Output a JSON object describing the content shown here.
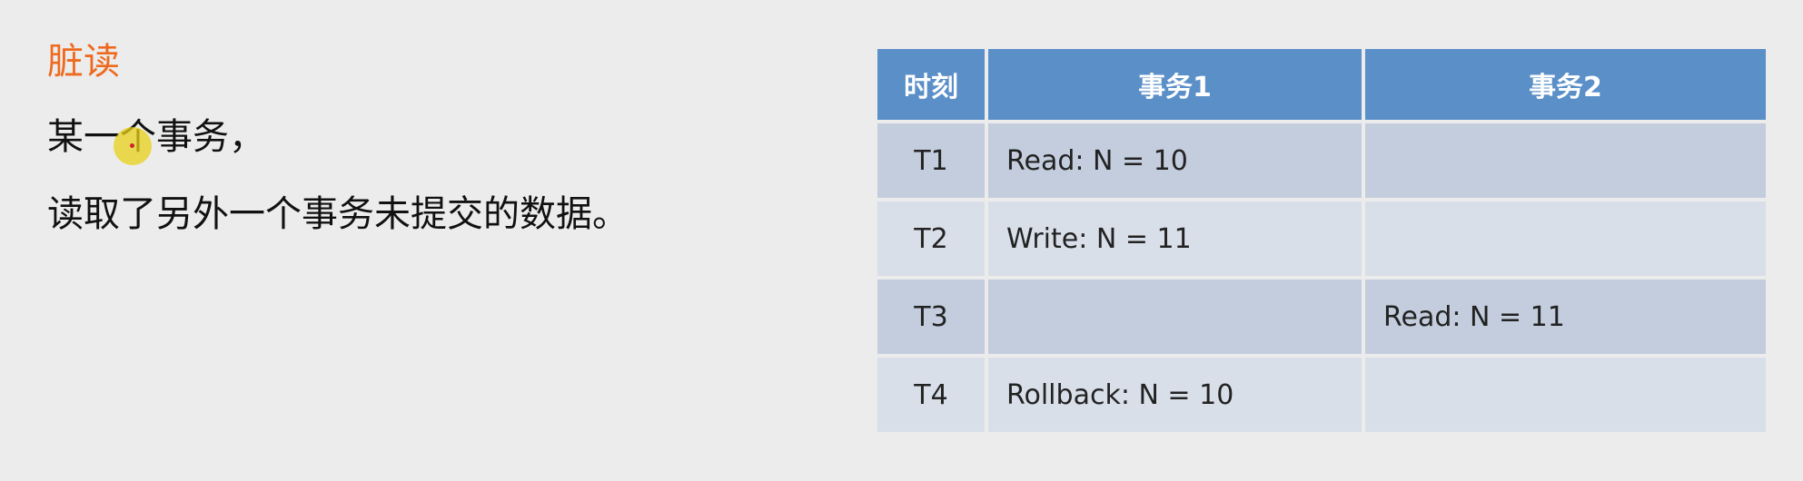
{
  "slide": {
    "title": "脏读",
    "line1": "某一个事务，",
    "line2": "读取了另外一个事务未提交的数据。"
  },
  "table": {
    "headers": [
      "时刻",
      "事务1",
      "事务2"
    ],
    "rows": [
      {
        "time": "T1",
        "tx1": "Read: N = 10",
        "tx2": ""
      },
      {
        "time": "T2",
        "tx1": "Write: N = 11",
        "tx2": ""
      },
      {
        "time": "T3",
        "tx1": "",
        "tx2": "Read: N = 11"
      },
      {
        "time": "T4",
        "tx1": "Rollback: N = 10",
        "tx2": ""
      }
    ]
  },
  "colors": {
    "title": "#ee6a1f",
    "header_bg": "#5b8fc8",
    "row_odd_bg": "#c3cddd",
    "row_even_bg": "#d9dfe9",
    "page_bg": "#ececec",
    "cursor_highlight": "#e8d218"
  }
}
